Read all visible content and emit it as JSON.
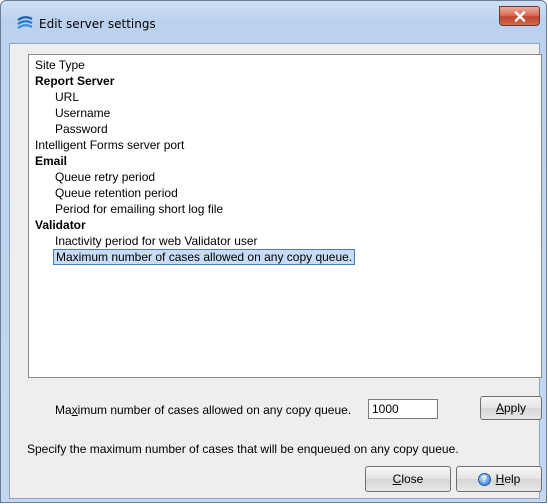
{
  "window": {
    "title": "Edit server settings"
  },
  "tree": {
    "items": [
      {
        "label": "Site Type",
        "level": 0,
        "bold": false,
        "selected": false
      },
      {
        "label": "Report Server",
        "level": 0,
        "bold": true,
        "selected": false
      },
      {
        "label": "URL",
        "level": 1,
        "bold": false,
        "selected": false
      },
      {
        "label": "Username",
        "level": 1,
        "bold": false,
        "selected": false
      },
      {
        "label": "Password",
        "level": 1,
        "bold": false,
        "selected": false
      },
      {
        "label": "Intelligent Forms server port",
        "level": 0,
        "bold": false,
        "selected": false
      },
      {
        "label": "Email",
        "level": 0,
        "bold": true,
        "selected": false
      },
      {
        "label": "Queue retry period",
        "level": 1,
        "bold": false,
        "selected": false
      },
      {
        "label": "Queue retention period",
        "level": 1,
        "bold": false,
        "selected": false
      },
      {
        "label": "Period for emailing short log file",
        "level": 1,
        "bold": false,
        "selected": false
      },
      {
        "label": "Validator",
        "level": 0,
        "bold": true,
        "selected": false
      },
      {
        "label": "Inactivity period for web Validator user",
        "level": 1,
        "bold": false,
        "selected": false
      },
      {
        "label": "Maximum number of cases allowed on any copy queue.",
        "level": 1,
        "bold": false,
        "selected": true
      }
    ]
  },
  "editor": {
    "label_prefix": "Ma",
    "label_mnemonic": "x",
    "label_suffix": "imum number of cases allowed on any copy queue.",
    "value": "1000",
    "apply_prefix": "",
    "apply_mnemonic": "A",
    "apply_suffix": "pply"
  },
  "description": "Specify the maximum number of cases that will be enqueued on any copy queue.",
  "buttons": {
    "close_mnemonic": "C",
    "close_suffix": "lose",
    "help_mnemonic": "H",
    "help_suffix": "elp"
  },
  "icons": {
    "app": "edit-server-app-icon",
    "close": "close-icon",
    "help": "help-icon"
  }
}
